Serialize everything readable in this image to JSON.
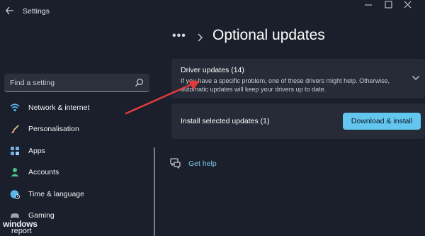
{
  "window": {
    "title": "Settings",
    "icons": {
      "back": "back-arrow-icon",
      "minimize": "minimize-icon",
      "maximize": "maximize-icon",
      "close": "close-icon"
    }
  },
  "sidebar": {
    "search": {
      "placeholder": "Find a setting",
      "icon": "search-icon"
    },
    "items": [
      {
        "label": "Network & internet",
        "icon": "wifi-icon",
        "color": "#59b4f0"
      },
      {
        "label": "Personalisation",
        "icon": "brush-icon",
        "color": "#e8a07a"
      },
      {
        "label": "Apps",
        "icon": "apps-icon",
        "color": "#6fb0e8"
      },
      {
        "label": "Accounts",
        "icon": "person-icon",
        "color": "#4cc38a"
      },
      {
        "label": "Time & language",
        "icon": "globe-clock-icon",
        "color": "#57b6ea"
      },
      {
        "label": "Gaming",
        "icon": "gamepad-icon",
        "color": "#9aa3b0"
      }
    ]
  },
  "main": {
    "breadcrumb": {
      "more": "•••",
      "chevron_icon": "chevron-right-icon"
    },
    "title": "Optional updates",
    "drivers_card": {
      "title": "Driver updates (14)",
      "description": "If you have a specific problem, one of these drivers might help. Otherwise, automatic updates will keep your drivers up to date.",
      "chevron_icon": "chevron-down-icon"
    },
    "install_card": {
      "label": "Install selected updates (1)",
      "button": "Download & install"
    },
    "help": {
      "label": "Get help",
      "icon": "help-icon"
    }
  },
  "watermark": {
    "line1": "windows",
    "line2": "report"
  },
  "colors": {
    "accent": "#63c6ef",
    "link": "#7cc7ee",
    "background": "#1a1f2b",
    "card": "#262b37",
    "annotation_arrow": "#e03b3b"
  }
}
